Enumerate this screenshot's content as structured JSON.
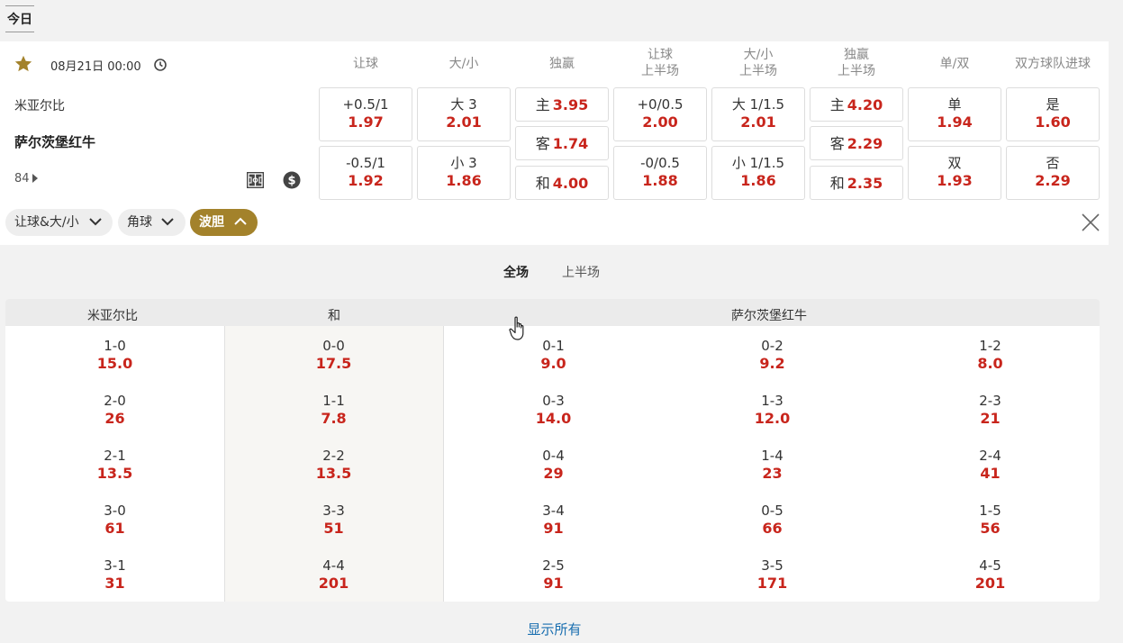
{
  "top": {
    "tab": "今日"
  },
  "match": {
    "datetime": "08月21日 00:00",
    "home": "米亚尔比",
    "away": "萨尔茨堡红牛",
    "more": "84"
  },
  "markets": [
    {
      "head1": "让球",
      "head2": "",
      "cells": [
        {
          "lbl": "+0.5/1",
          "val": "1.97"
        },
        {
          "lbl": "-0.5/1",
          "val": "1.92"
        }
      ]
    },
    {
      "head1": "大/小",
      "head2": "",
      "cells": [
        {
          "lbl": "大 3",
          "val": "2.01"
        },
        {
          "lbl": "小 3",
          "val": "1.86"
        }
      ]
    },
    {
      "head1": "独赢",
      "head2": "",
      "cells": [
        {
          "lbl": "主",
          "val": "3.95"
        },
        {
          "lbl": "客",
          "val": "1.74"
        },
        {
          "lbl": "和",
          "val": "4.00"
        }
      ]
    },
    {
      "head1": "让球",
      "head2": "上半场",
      "cells": [
        {
          "lbl": "+0/0.5",
          "val": "2.00"
        },
        {
          "lbl": "-0/0.5",
          "val": "1.88"
        }
      ]
    },
    {
      "head1": "大/小",
      "head2": "上半场",
      "cells": [
        {
          "lbl": "大 1/1.5",
          "val": "2.01"
        },
        {
          "lbl": "小 1/1.5",
          "val": "1.86"
        }
      ]
    },
    {
      "head1": "独赢",
      "head2": "上半场",
      "cells": [
        {
          "lbl": "主",
          "val": "4.20"
        },
        {
          "lbl": "客",
          "val": "2.29"
        },
        {
          "lbl": "和",
          "val": "2.35"
        }
      ]
    },
    {
      "head1": "单/双",
      "head2": "",
      "cells": [
        {
          "lbl": "单",
          "val": "1.94"
        },
        {
          "lbl": "双",
          "val": "1.93"
        }
      ]
    },
    {
      "head1": "双方球队进球",
      "head2": "",
      "cells": [
        {
          "lbl": "是",
          "val": "1.60"
        },
        {
          "lbl": "否",
          "val": "2.29"
        }
      ]
    }
  ],
  "filters": [
    "让球&大/小",
    "角球",
    "波胆"
  ],
  "periods": [
    "全场",
    "上半场"
  ],
  "correct_score": {
    "headers": {
      "home": "米亚尔比",
      "draw": "和",
      "away": "萨尔茨堡红牛"
    },
    "columns": [
      [
        {
          "s": "1-0",
          "o": "15.0"
        },
        {
          "s": "2-0",
          "o": "26"
        },
        {
          "s": "2-1",
          "o": "13.5"
        },
        {
          "s": "3-0",
          "o": "61"
        },
        {
          "s": "3-1",
          "o": "31"
        }
      ],
      [
        {
          "s": "0-0",
          "o": "17.5"
        },
        {
          "s": "1-1",
          "o": "7.8"
        },
        {
          "s": "2-2",
          "o": "13.5"
        },
        {
          "s": "3-3",
          "o": "51"
        },
        {
          "s": "4-4",
          "o": "201"
        }
      ],
      [
        {
          "s": "0-1",
          "o": "9.0"
        },
        {
          "s": "0-3",
          "o": "14.0"
        },
        {
          "s": "0-4",
          "o": "29"
        },
        {
          "s": "3-4",
          "o": "91"
        },
        {
          "s": "2-5",
          "o": "91"
        }
      ],
      [
        {
          "s": "0-2",
          "o": "9.2"
        },
        {
          "s": "1-3",
          "o": "12.0"
        },
        {
          "s": "1-4",
          "o": "23"
        },
        {
          "s": "0-5",
          "o": "66"
        },
        {
          "s": "3-5",
          "o": "171"
        }
      ],
      [
        {
          "s": "1-2",
          "o": "8.0"
        },
        {
          "s": "2-3",
          "o": "21"
        },
        {
          "s": "2-4",
          "o": "41"
        },
        {
          "s": "1-5",
          "o": "56"
        },
        {
          "s": "4-5",
          "o": "201"
        }
      ]
    ]
  },
  "show_all": "显示所有",
  "colors": {
    "odds": "#c8251c",
    "accent": "#a3822b",
    "link": "#1a6fb0"
  }
}
